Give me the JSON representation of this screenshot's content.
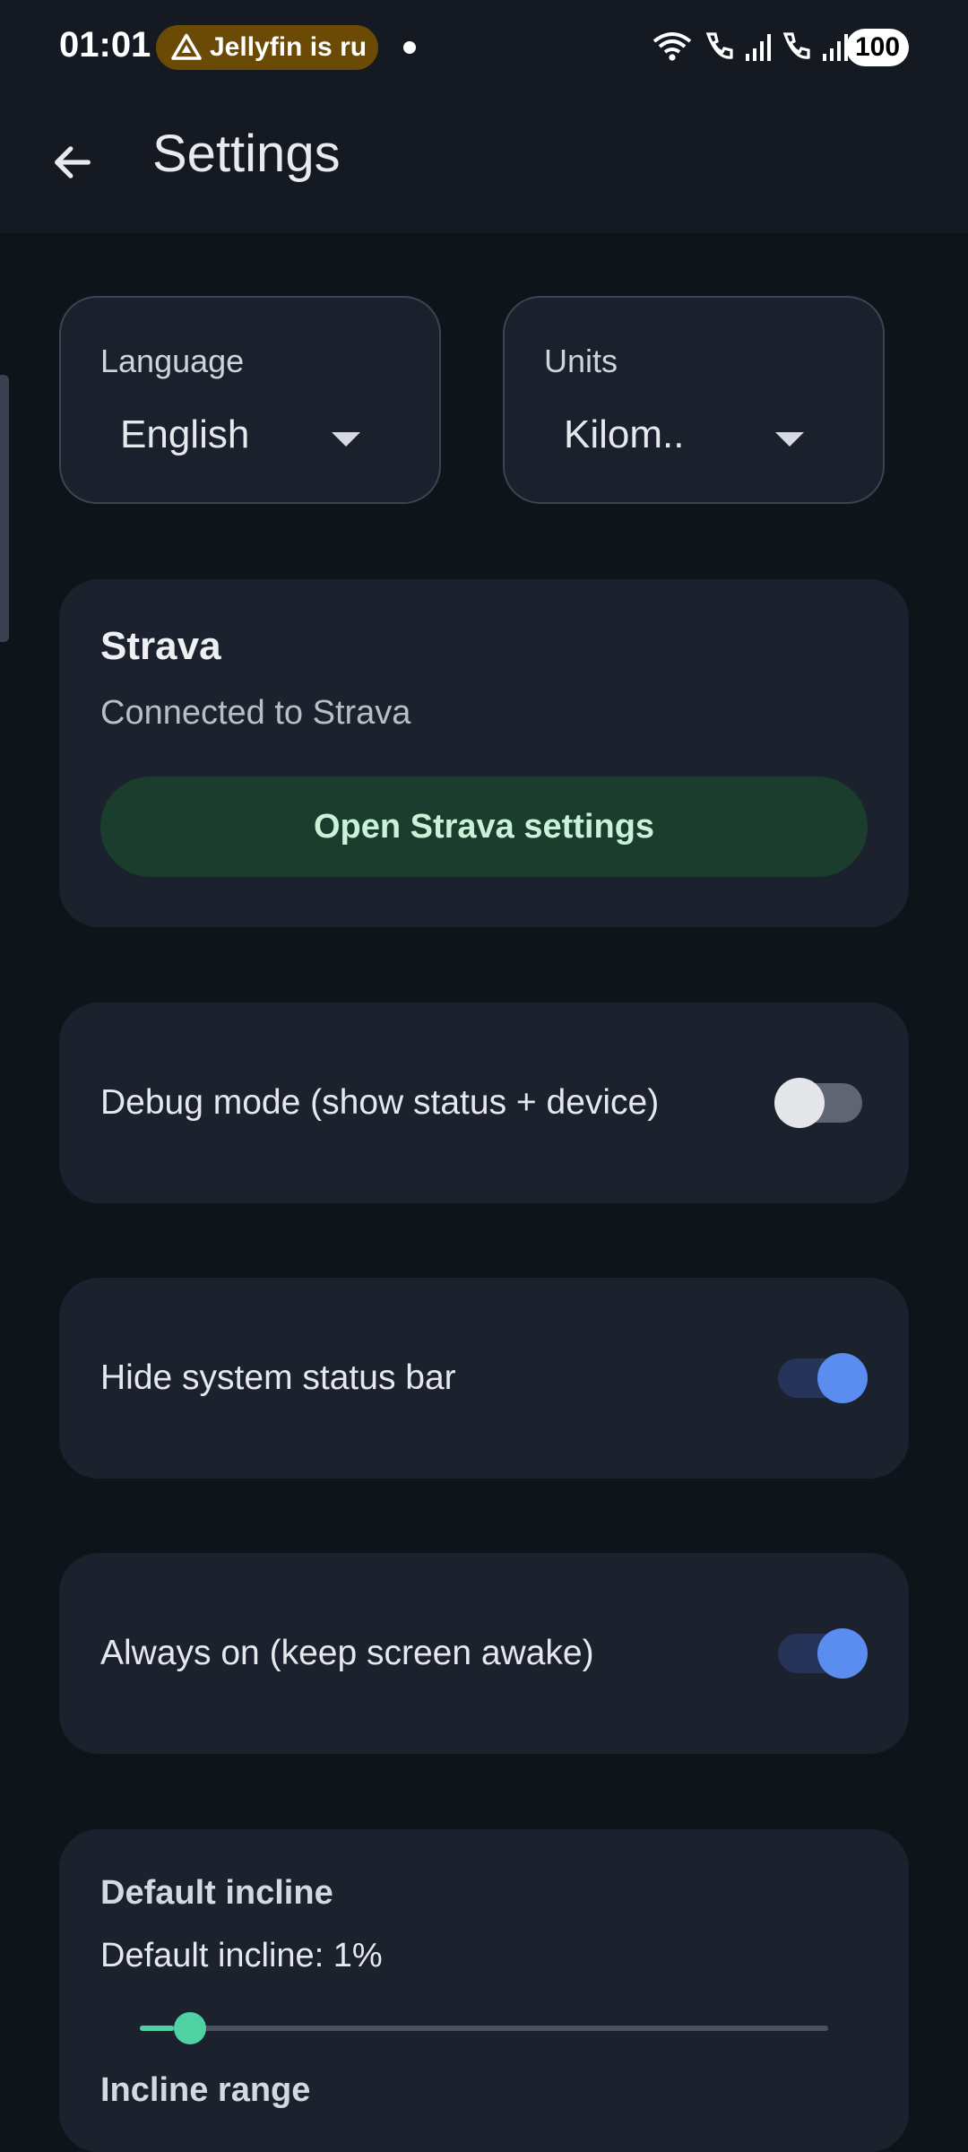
{
  "status_bar": {
    "time": "01:01",
    "notification_text": "Jellyfin is ru",
    "battery": "100"
  },
  "app_bar": {
    "title": "Settings"
  },
  "language": {
    "label": "Language",
    "value": "English"
  },
  "units": {
    "label": "Units",
    "value": "Kilom.."
  },
  "strava": {
    "title": "Strava",
    "status": "Connected to Strava",
    "button_label": "Open Strava settings"
  },
  "toggles": {
    "debug": {
      "label": "Debug mode (show status + device)",
      "on": false
    },
    "hide_status_bar": {
      "label": "Hide system status bar",
      "on": true
    },
    "always_on": {
      "label": "Always on (keep screen awake)",
      "on": true
    }
  },
  "incline": {
    "section_title": "Default incline",
    "value_text": "Default incline: 1%",
    "slider_fraction": 0.05,
    "next_section_title": "Incline range"
  },
  "colors": {
    "background": "#0f131a",
    "card": "#1c222d",
    "accent_blue": "#5b8cf0",
    "accent_green": "#4fd1a3",
    "strava_button": "#1b3d2d"
  }
}
